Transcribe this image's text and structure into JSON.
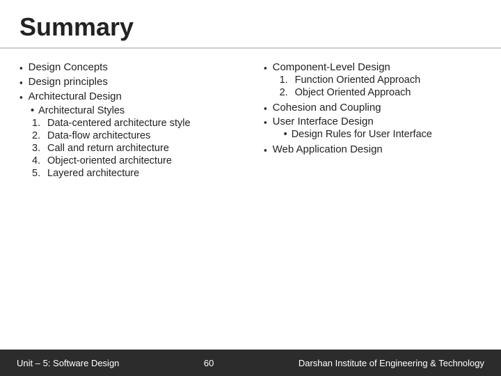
{
  "header": {
    "title": "Summary"
  },
  "left_col": {
    "items": [
      {
        "label": "Design Concepts"
      },
      {
        "label": "Design principles"
      },
      {
        "label": "Architectural Design"
      }
    ],
    "sub_heading": "Architectural Styles",
    "numbered_items": [
      {
        "num": "1.",
        "label": "Data-centered architecture style"
      },
      {
        "num": "2.",
        "label": "Data-flow architectures"
      },
      {
        "num": "3.",
        "label": "Call and return architecture"
      },
      {
        "num": "4.",
        "label": "Object-oriented architecture"
      },
      {
        "num": "5.",
        "label": "Layered architecture"
      }
    ]
  },
  "right_col": {
    "component_level": "Component-Level Design",
    "numbered_right": [
      {
        "num": "1.",
        "label": "Function Oriented Approach"
      },
      {
        "num": "2.",
        "label": "Object Oriented Approach"
      }
    ],
    "items": [
      {
        "label": "Cohesion and Coupling"
      },
      {
        "label": "User Interface Design"
      }
    ],
    "ui_sub": "Design Rules for User Interface",
    "web_label": "Web Application Design"
  },
  "footer": {
    "left": "Unit – 5: Software Design",
    "center": "60",
    "right": "Darshan Institute of Engineering & Technology"
  }
}
